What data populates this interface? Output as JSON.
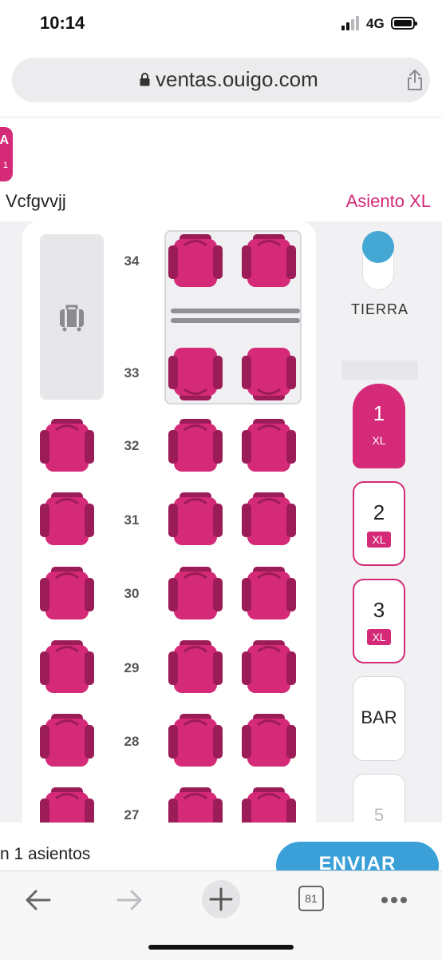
{
  "status_bar": {
    "time": "10:14",
    "network": "4G"
  },
  "browser": {
    "url": "ventas.ouigo.com"
  },
  "header": {
    "coach_tab_partial": {
      "letter": "A",
      "sub": "1"
    },
    "passenger_name": "Vcfgvvjj",
    "seat_type": "Asiento XL"
  },
  "seat_map": {
    "luggage_icon": "suitcase-icon",
    "rows": [
      "34",
      "33",
      "32",
      "31",
      "30",
      "29",
      "28",
      "27"
    ],
    "seat_color": "#d42a78",
    "seat_back_color": "#9c1c57"
  },
  "side_panel": {
    "ground_label": "TIERRA",
    "coaches": [
      {
        "number": "1",
        "badge": "XL",
        "state": "active"
      },
      {
        "number": "2",
        "badge": "XL",
        "state": "outline"
      },
      {
        "number": "3",
        "badge": "XL",
        "state": "outline"
      },
      {
        "number": "BAR",
        "badge": "",
        "state": "plain"
      },
      {
        "number": "5",
        "badge": "",
        "state": "plain"
      }
    ]
  },
  "bottom": {
    "seats_text": "n 1 asientos",
    "send_label": "ENVIAR"
  },
  "toolbar": {
    "tabs_count": "81"
  },
  "colors": {
    "brand_pink": "#d42a78",
    "accent_blue": "#3b9fd8"
  }
}
